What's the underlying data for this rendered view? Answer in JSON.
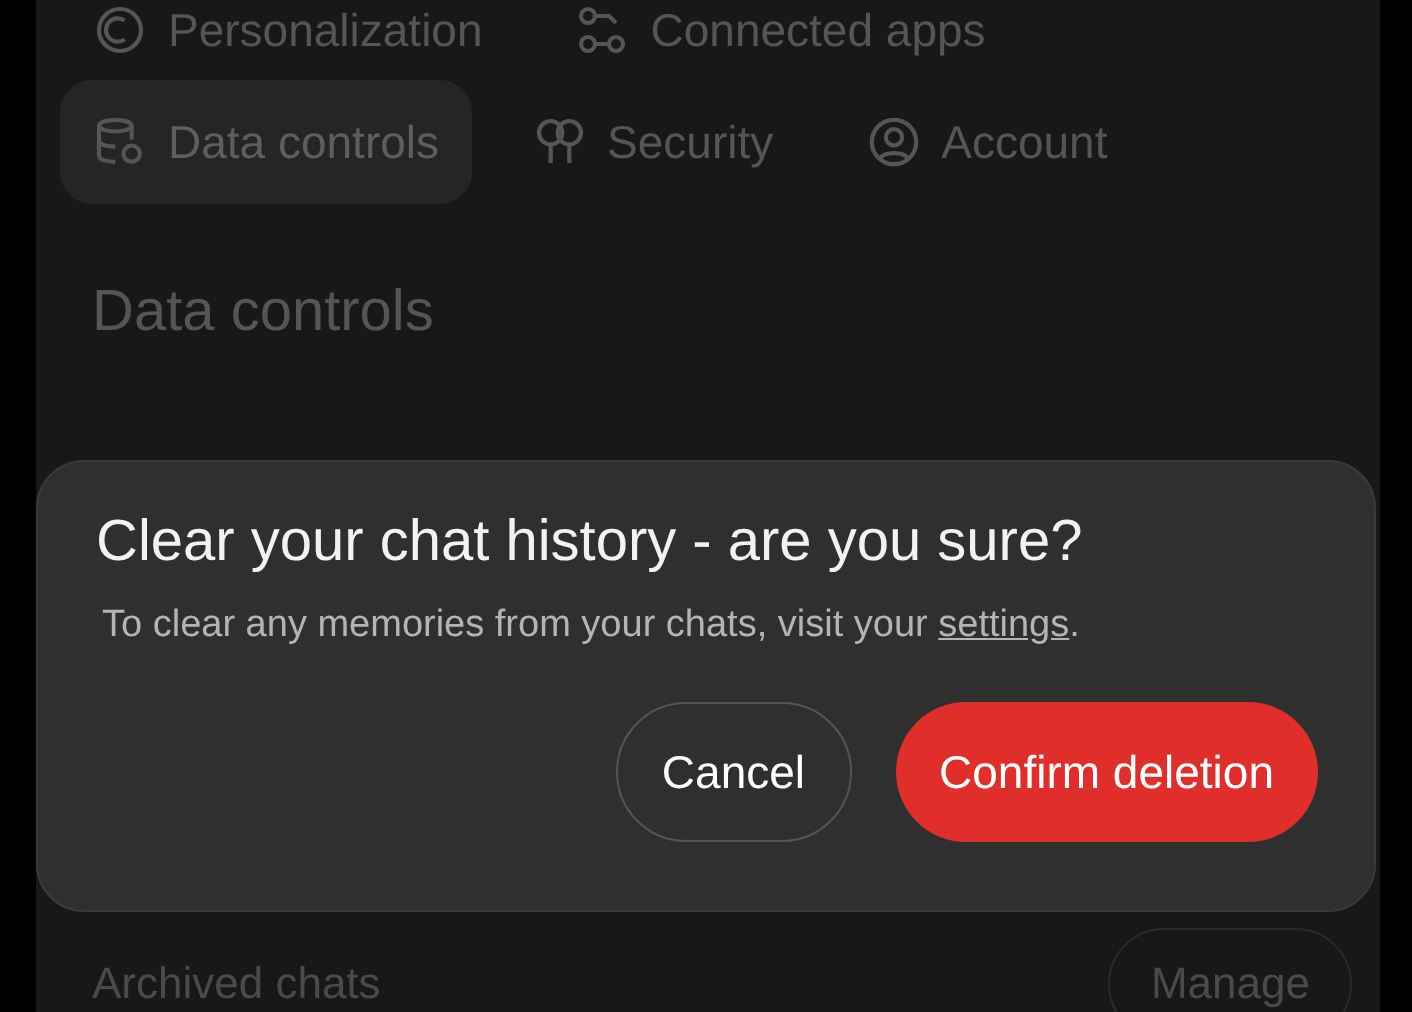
{
  "tabs": [
    {
      "label": "Personalization",
      "selected": false
    },
    {
      "label": "Connected apps",
      "selected": false
    },
    {
      "label": "Data controls",
      "selected": true
    },
    {
      "label": "Security",
      "selected": false
    },
    {
      "label": "Account",
      "selected": false
    }
  ],
  "section_title": "Data controls",
  "settings_row": {
    "label": "Archived chats",
    "button": "Manage"
  },
  "dialog": {
    "title": "Clear your chat history - are you sure?",
    "message_before": "To clear any memories from your chats, visit your ",
    "link": "settings",
    "message_after": ".",
    "buttons": [
      {
        "label": "Cancel",
        "kind": "secondary"
      },
      {
        "label": "Confirm deletion",
        "kind": "danger"
      }
    ]
  }
}
